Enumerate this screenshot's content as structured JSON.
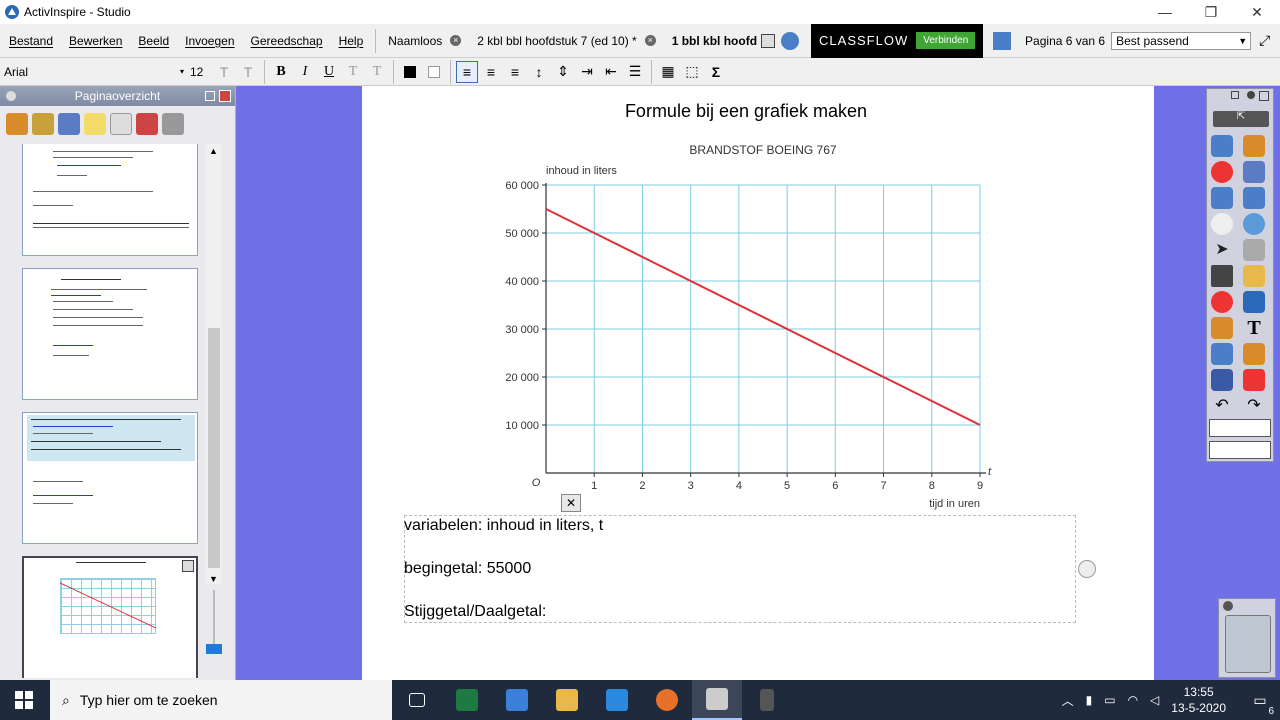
{
  "window": {
    "title": "ActivInspire - Studio"
  },
  "menu": [
    "Bestand",
    "Bewerken",
    "Beeld",
    "Invoegen",
    "Gereedschap",
    "Help"
  ],
  "tabs": [
    {
      "label": "Naamloos"
    },
    {
      "label": "2 kbl bbl hoofdstuk 7 (ed 10) *"
    },
    {
      "label": "1 bbl kbl hoofd"
    }
  ],
  "classflow": {
    "label": "CLASSFLOW",
    "button": "Verbinden"
  },
  "pagination": {
    "label": "Pagina 6 van 6",
    "zoom": "Best passend"
  },
  "format": {
    "font": "Arial",
    "size": "12"
  },
  "left_panel": {
    "title": "Paginaoverzicht"
  },
  "page": {
    "heading": "Formule bij een grafiek maken",
    "text_lines": [
      "variabelen: inhoud in liters, t",
      "begingetal: 55000",
      "Stijggetal/Daalgetal:"
    ]
  },
  "chart_data": {
    "type": "line",
    "title": "BRANDSTOF BOEING 767",
    "ylabel": "inhoud in liters",
    "xlabel": "tijd in uren",
    "x_axis_symbol": "t",
    "origin_label": "O",
    "xlim": [
      0,
      9
    ],
    "ylim": [
      0,
      60000
    ],
    "x_ticks": [
      "1",
      "2",
      "3",
      "4",
      "5",
      "6",
      "7",
      "8",
      "9"
    ],
    "y_ticks": [
      "10 000",
      "20 000",
      "30 000",
      "40 000",
      "50 000",
      "60 000"
    ],
    "grid": true,
    "series": [
      {
        "x": [
          0,
          9
        ],
        "y": [
          55000,
          10000
        ],
        "color": "#e0303a"
      }
    ]
  },
  "taskbar": {
    "search_placeholder": "Typ hier om te zoeken",
    "time": "13:55",
    "date": "13-5-2020",
    "notifications": "6"
  }
}
